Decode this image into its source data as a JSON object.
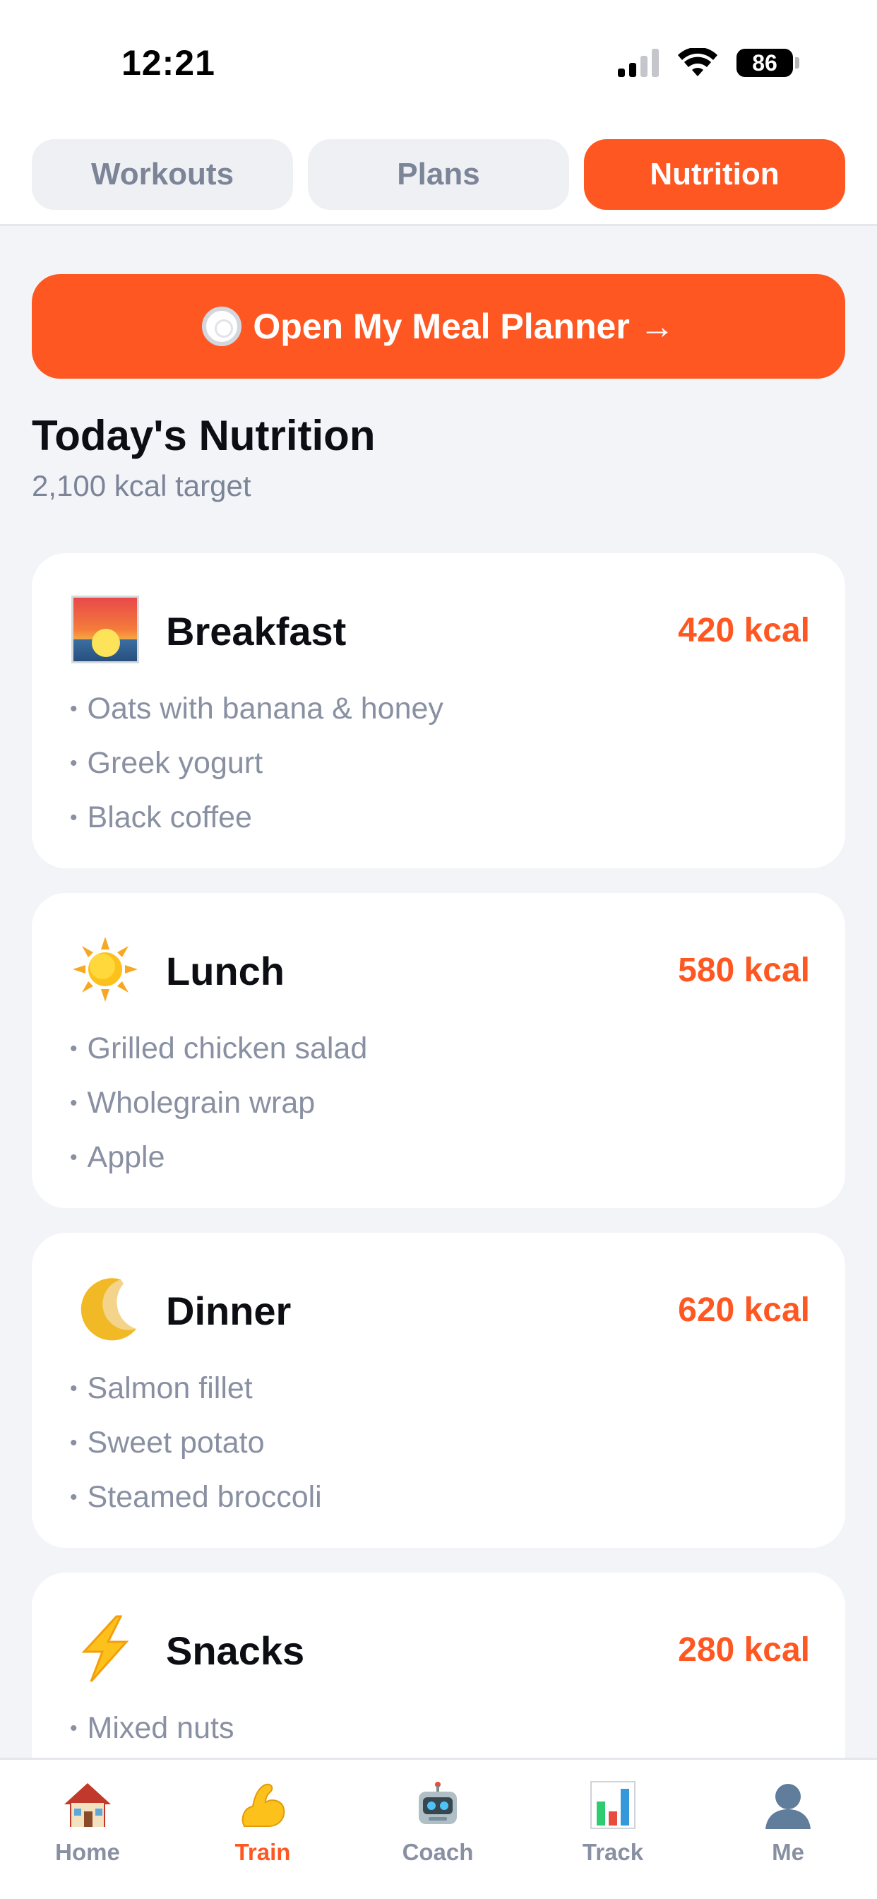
{
  "status_bar": {
    "time": "12:21",
    "battery": "86"
  },
  "tabs": [
    {
      "label": "Workouts",
      "active": false
    },
    {
      "label": "Plans",
      "active": false
    },
    {
      "label": "Nutrition",
      "active": true
    }
  ],
  "meal_planner_button": {
    "label": "Open My Meal Planner →",
    "icon": "plate-icon"
  },
  "nutrition": {
    "title": "Today's Nutrition",
    "subtitle": "2,100 kcal target",
    "meals": [
      {
        "name": "Breakfast",
        "kcal": "420 kcal",
        "icon": "sunrise-icon",
        "items": [
          "Oats with banana & honey",
          "Greek yogurt",
          "Black coffee"
        ]
      },
      {
        "name": "Lunch",
        "kcal": "580 kcal",
        "icon": "sun-icon",
        "items": [
          "Grilled chicken salad",
          "Wholegrain wrap",
          "Apple"
        ]
      },
      {
        "name": "Dinner",
        "kcal": "620 kcal",
        "icon": "moon-icon",
        "items": [
          "Salmon fillet",
          "Sweet potato",
          "Steamed broccoli"
        ]
      },
      {
        "name": "Snacks",
        "kcal": "280 kcal",
        "icon": "lightning-icon",
        "items": [
          "Mixed nuts"
        ]
      }
    ]
  },
  "bottom_nav": [
    {
      "label": "Home",
      "icon": "house-icon",
      "active": false
    },
    {
      "label": "Train",
      "icon": "flexed-biceps-icon",
      "active": true
    },
    {
      "label": "Coach",
      "icon": "robot-icon",
      "active": false
    },
    {
      "label": "Track",
      "icon": "bar-chart-icon",
      "active": false
    },
    {
      "label": "Me",
      "icon": "person-icon",
      "active": false
    }
  ],
  "colors": {
    "accent": "#ff5722",
    "background": "#f2f4f8",
    "muted": "#8890a2"
  }
}
